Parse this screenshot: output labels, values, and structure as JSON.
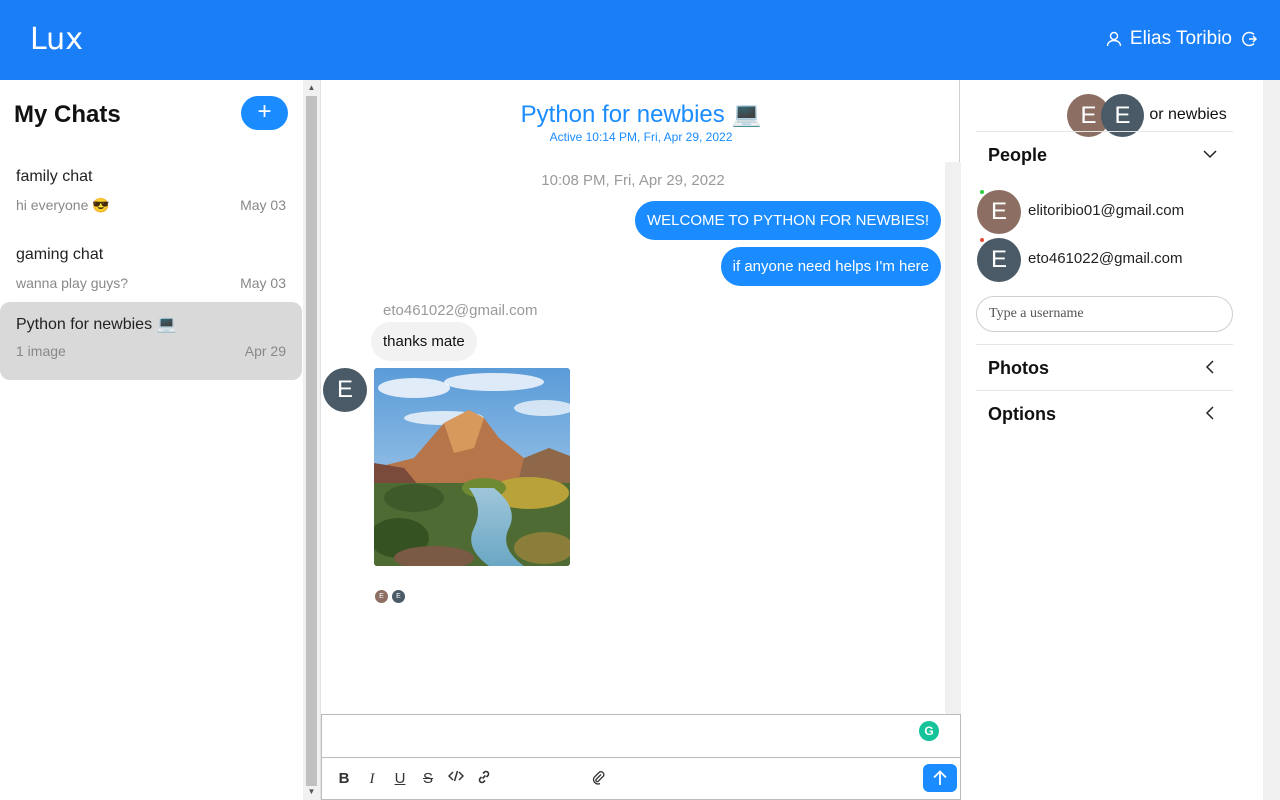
{
  "app": {
    "brand": "Lux"
  },
  "user": {
    "name": "Elias Toribio"
  },
  "sidebar": {
    "title": "My Chats",
    "add_label": "+",
    "chats": [
      {
        "name": "family chat",
        "last": "hi everyone 😎",
        "date": "May 03"
      },
      {
        "name": "gaming chat",
        "last": "wanna play guys?",
        "date": "May 03"
      },
      {
        "name": "Python for newbies 💻",
        "last": "1 image",
        "date": "Apr 29"
      }
    ]
  },
  "chat": {
    "title": "Python for newbies 💻",
    "subtitle": "Active 10:14 PM, Fri, Apr 29, 2022",
    "timestamp": "10:08 PM, Fri, Apr 29, 2022",
    "out_messages": [
      "WELCOME TO PYTHON FOR NEWBIES!",
      "if anyone need helps I'm here"
    ],
    "in_sender": "eto461022@gmail.com",
    "in_message": "thanks mate",
    "avatar_letter": "E"
  },
  "composer": {
    "grammarly": "G",
    "tools": [
      "B",
      "I",
      "U",
      "S"
    ]
  },
  "settings": {
    "title_visible": "or newbies",
    "avatar_letter": "E",
    "people_label": "People",
    "people": [
      {
        "email": "elitoribio01@gmail.com",
        "letter": "E",
        "color": "#8d6e63",
        "status": "#2ecc40"
      },
      {
        "email": "eto461022@gmail.com",
        "letter": "E",
        "color": "#4a5a66",
        "status": "#e74c3c"
      }
    ],
    "username_placeholder": "Type a username",
    "photos_label": "Photos",
    "options_label": "Options"
  },
  "colors": {
    "primary": "#1a7ff6",
    "accent": "#1a8cff",
    "active_chat": "#d9d9d9",
    "grammarly": "#15c39a"
  }
}
